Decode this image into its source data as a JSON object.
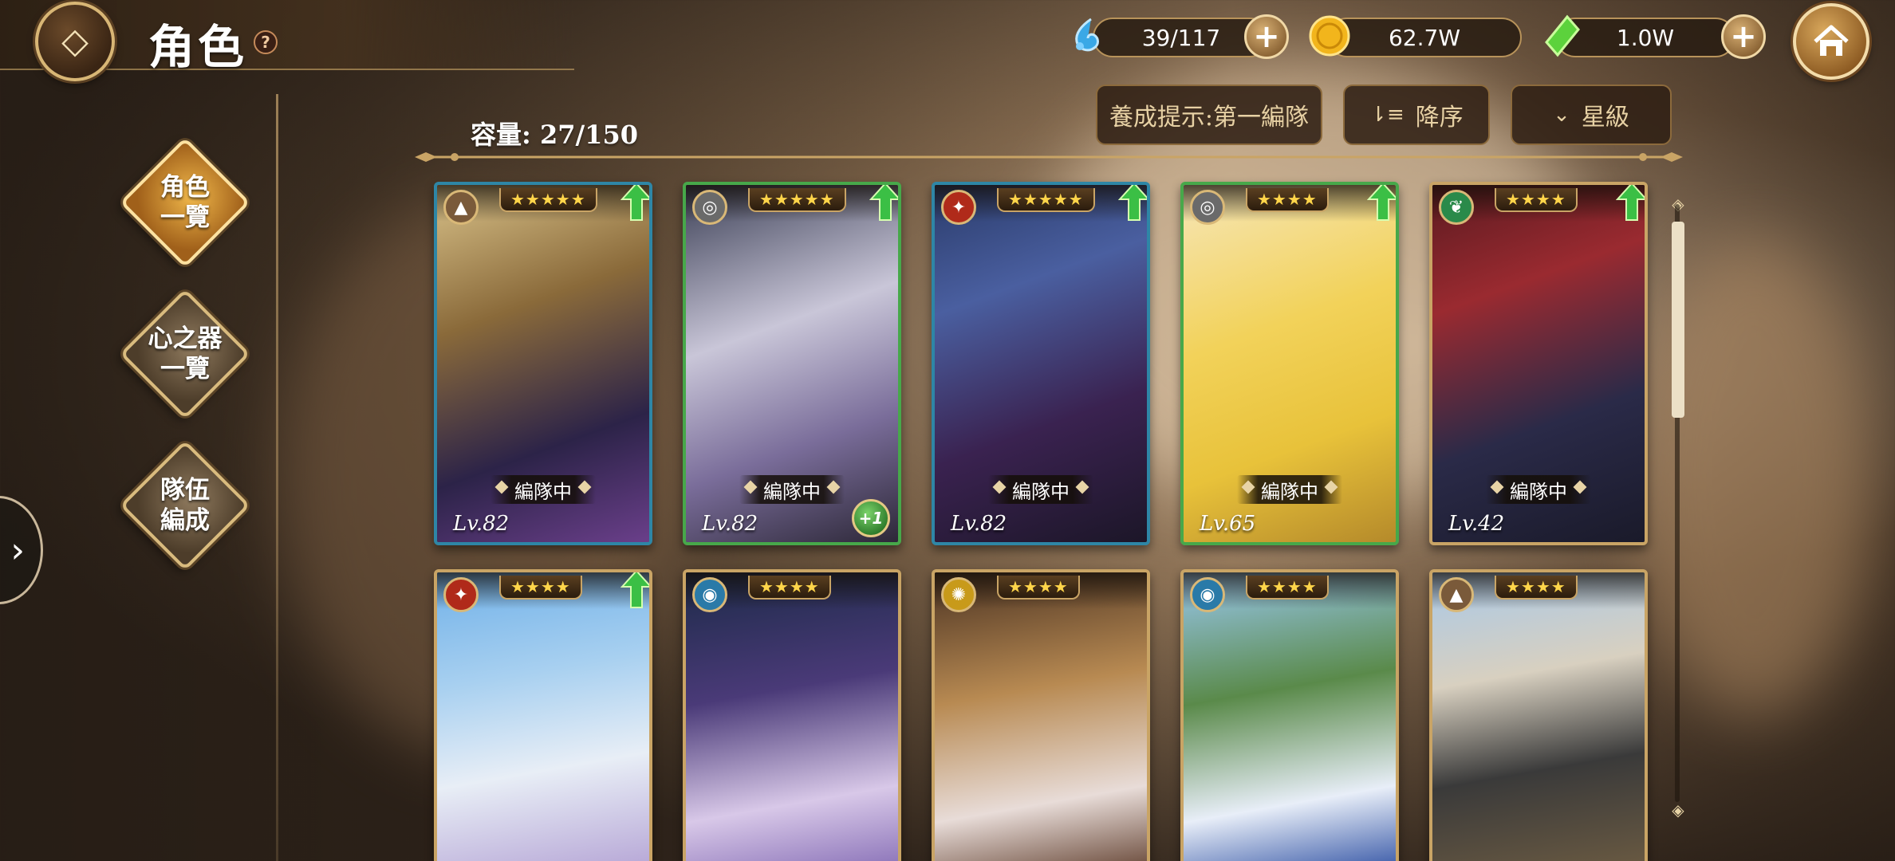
{
  "header": {
    "title": "角色",
    "help": "?"
  },
  "resources": {
    "stamina": "39/117",
    "gold": "62.7W",
    "gems": "1.0W"
  },
  "filters": {
    "hint": "養成提示:第一編隊",
    "sort": "降序",
    "sort_icon": "⇂≡",
    "filter": "星級",
    "filter_icon": "⌄"
  },
  "capacity": "容量: 27/150",
  "nav": [
    {
      "label_line1": "角色",
      "label_line2": "一覽",
      "active": true
    },
    {
      "label_line1": "心之器",
      "label_line2": "一覽",
      "active": false
    },
    {
      "label_line1": "隊伍",
      "label_line2": "編成",
      "active": false
    }
  ],
  "cards": [
    {
      "stars": "★★★★★",
      "element": "earth",
      "badge": "編隊中",
      "level": "Lv.82",
      "up": true,
      "plus": ""
    },
    {
      "stars": "★★★★★",
      "element": "wind",
      "badge": "編隊中",
      "level": "Lv.82",
      "up": true,
      "plus": "+1"
    },
    {
      "stars": "★★★★★",
      "element": "fire",
      "badge": "編隊中",
      "level": "Lv.82",
      "up": true,
      "plus": ""
    },
    {
      "stars": "★★★★",
      "element": "wind",
      "badge": "編隊中",
      "level": "Lv.65",
      "up": true,
      "plus": ""
    },
    {
      "stars": "★★★★",
      "element": "leaf",
      "badge": "編隊中",
      "level": "Lv.42",
      "up": true,
      "plus": ""
    },
    {
      "stars": "★★★★",
      "element": "fire",
      "badge": "",
      "level": "",
      "up": true,
      "plus": ""
    },
    {
      "stars": "★★★★",
      "element": "water",
      "badge": "",
      "level": "",
      "up": false,
      "plus": ""
    },
    {
      "stars": "★★★★",
      "element": "light",
      "badge": "",
      "level": "",
      "up": false,
      "plus": ""
    },
    {
      "stars": "★★★★",
      "element": "water",
      "badge": "",
      "level": "",
      "up": false,
      "plus": ""
    },
    {
      "stars": "★★★★",
      "element": "earth",
      "badge": "",
      "level": "",
      "up": false,
      "plus": ""
    }
  ],
  "colors": {
    "accent_gold": "#c9a465",
    "stars": "#ffd54a",
    "up_arrow": "#3bbf45"
  }
}
